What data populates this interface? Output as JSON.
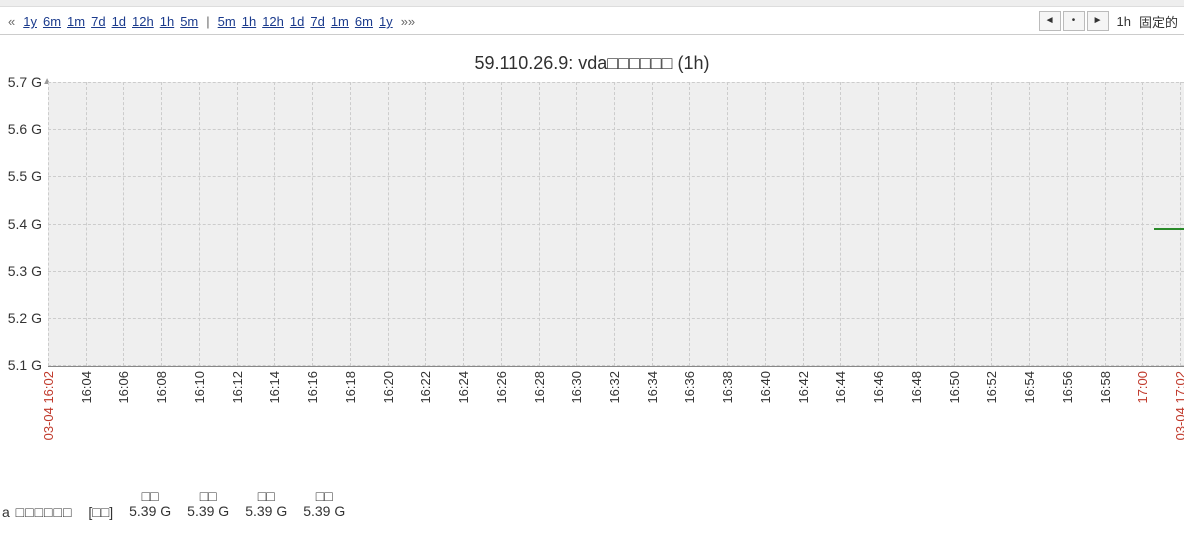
{
  "toolbar": {
    "left_links_prefix": "«",
    "left_links": [
      "1y",
      "6m",
      "1m",
      "7d",
      "1d",
      "12h",
      "1h",
      "5m"
    ],
    "separator": "|",
    "right_links": [
      "5m",
      "1h",
      "12h",
      "1d",
      "7d",
      "1m",
      "6m",
      "1y"
    ],
    "right_links_suffix": "»»",
    "nav_prev": "◄",
    "nav_dot": "•",
    "nav_next": "►",
    "current_range": "1h",
    "fixed_label": "固定的"
  },
  "chart_data": {
    "type": "line",
    "title": "59.110.26.9: vda□□□□□□ (1h)",
    "ylabel": "G",
    "ylim": [
      5.1,
      5.7
    ],
    "y_ticks": [
      "5.7 G",
      "5.6 G",
      "5.5 G",
      "5.4 G",
      "5.3 G",
      "5.2 G",
      "5.1 G"
    ],
    "x_ticks": [
      {
        "label": "03-04 16:02",
        "red": true
      },
      {
        "label": "16:04"
      },
      {
        "label": "16:06"
      },
      {
        "label": "16:08"
      },
      {
        "label": "16:10"
      },
      {
        "label": "16:12"
      },
      {
        "label": "16:14"
      },
      {
        "label": "16:16"
      },
      {
        "label": "16:18"
      },
      {
        "label": "16:20"
      },
      {
        "label": "16:22"
      },
      {
        "label": "16:24"
      },
      {
        "label": "16:26"
      },
      {
        "label": "16:28"
      },
      {
        "label": "16:30"
      },
      {
        "label": "16:32"
      },
      {
        "label": "16:34"
      },
      {
        "label": "16:36"
      },
      {
        "label": "16:38"
      },
      {
        "label": "16:40"
      },
      {
        "label": "16:42"
      },
      {
        "label": "16:44"
      },
      {
        "label": "16:46"
      },
      {
        "label": "16:48"
      },
      {
        "label": "16:50"
      },
      {
        "label": "16:52"
      },
      {
        "label": "16:54"
      },
      {
        "label": "16:56"
      },
      {
        "label": "16:58"
      },
      {
        "label": "17:00",
        "red": true
      },
      {
        "label": "03-04 17:02",
        "red": true
      }
    ],
    "series": [
      {
        "name": "vda □□□□□□",
        "x": [
          "17:00",
          "17:02"
        ],
        "values": [
          5.39,
          5.39
        ]
      }
    ],
    "constant_value": 5.39
  },
  "legend": {
    "series_label": "a □□□□□□",
    "all_label": "[□□]",
    "stats": [
      {
        "header": "□□",
        "value": "5.39 G"
      },
      {
        "header": "□□",
        "value": "5.39 G"
      },
      {
        "header": "□□",
        "value": "5.39 G"
      },
      {
        "header": "□□",
        "value": "5.39 G"
      }
    ]
  }
}
